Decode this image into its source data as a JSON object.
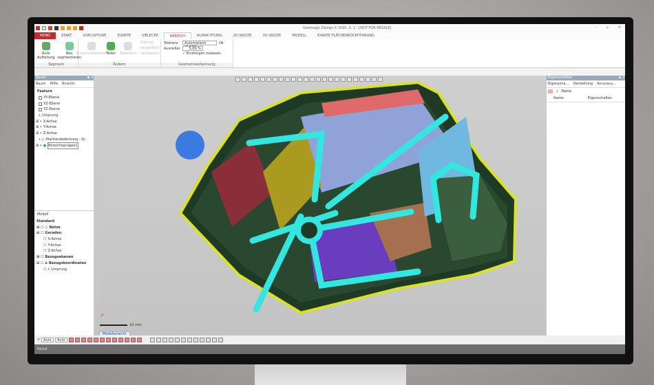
{
  "window": {
    "title": "Geomagic Design X 2020. 0. 2 - [NOT FOR RESALE]",
    "controls": [
      "–",
      "▫",
      "×"
    ]
  },
  "tabs": [
    {
      "label": "MENÜ"
    },
    {
      "label": "START"
    },
    {
      "label": "LIVECAPTURE"
    },
    {
      "label": "PUNKTE"
    },
    {
      "label": "VIELECKE"
    },
    {
      "label": "BEREICH",
      "active": true
    },
    {
      "label": "AUSRICHTUNG"
    },
    {
      "label": "2D-SKIZZE"
    },
    {
      "label": "3D-SKIZZE"
    },
    {
      "label": "MODELL"
    },
    {
      "label": "EXAKTE FLÄCHENRÜCKFÜHRUNG"
    }
  ],
  "ribbon": {
    "segment": {
      "label": "Segment",
      "buttons": [
        "Auto Aufteilung",
        "Neu segmentieren"
      ]
    },
    "aendern": {
      "label": "Ändern",
      "buttons": [
        "Zusammenfassen",
        "Teilen",
        "Erweitern"
      ],
      "small": [
        "Kleinen",
        "Vergrößern",
        "Verkleinern"
      ]
    },
    "geometrie": {
      "label": "Geometrieerkennung",
      "toleranz_label": "Toleranz",
      "toleranz_value": "Automatisch (0,177",
      "ok": "Ok",
      "ausreisser_label": "Ausreißer",
      "ausreisser_value": "5,00 %",
      "checkbox": "Eindringen zulassen"
    }
  },
  "left_panel": {
    "title": "Baum",
    "tabs": [
      "Baum",
      "Hilfe",
      "Ansicht"
    ],
    "feature_header": "Feature",
    "features": [
      "XY-Ebene",
      "XZ-Ebene",
      "YZ-Ebene",
      "Ursprung",
      "X-Achse",
      "Y-Achse",
      "Z-Achse",
      "Markierabdeckung - Sc",
      "Bereichsgruppe1"
    ],
    "model_header": "Modell",
    "model": [
      "Standard",
      "Netze",
      "Geraden",
      "X-Achse",
      "Y-Achse",
      "Z-Achse",
      "Bezugsebenen",
      "Bezugskoordinaten",
      "Ursprung"
    ]
  },
  "right_panel": {
    "title": "Eigenschaften",
    "tabs": [
      "Eigenscha...",
      "Darstellung",
      "Accuracy..."
    ],
    "sort": "Name",
    "columns": [
      "Name",
      "Eigenschaften"
    ]
  },
  "viewport": {
    "tab": "Modellansicht",
    "scale": "10 mm"
  },
  "bottom": {
    "select1": "Auto",
    "select2": "Auto"
  },
  "status": "Bereit",
  "colors": {
    "accent": "#c42b2b",
    "highlight": "#33e6e0"
  }
}
